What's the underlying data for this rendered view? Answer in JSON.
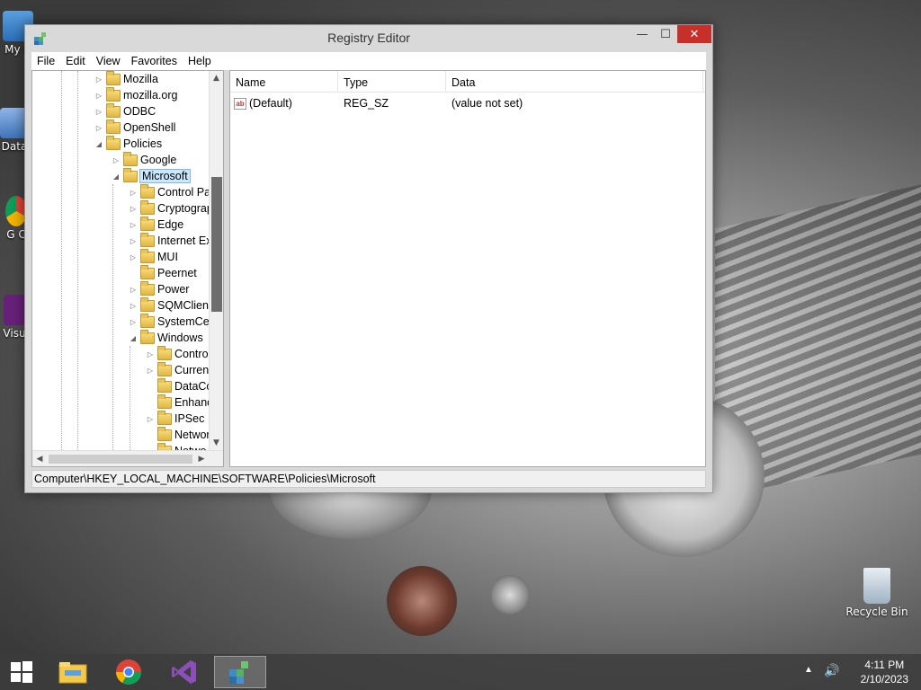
{
  "desktop": {
    "icons": [
      {
        "name": "my-computer-icon",
        "label": "My C"
      },
      {
        "name": "data-shortcut-icon",
        "label": "Data"
      },
      {
        "name": "google-chrome-shortcut-icon",
        "label": "G C"
      },
      {
        "name": "visual-studio-shortcut-icon",
        "label": "Visu"
      },
      {
        "name": "recycle-bin-icon",
        "label": "Recycle Bin"
      }
    ]
  },
  "window": {
    "title": "Registry Editor",
    "controls": {
      "minimize": "—",
      "maximize": "☐",
      "close": "✕"
    }
  },
  "menubar": {
    "items": [
      "File",
      "Edit",
      "View",
      "Favorites",
      "Help"
    ]
  },
  "tree": {
    "rows": [
      {
        "label": "Mozilla",
        "expander": "▷",
        "depth": 0
      },
      {
        "label": "mozilla.org",
        "expander": "▷",
        "depth": 0
      },
      {
        "label": "ODBC",
        "expander": "▷",
        "depth": 0
      },
      {
        "label": "OpenShell",
        "expander": "▷",
        "depth": 0
      },
      {
        "label": "Policies",
        "expander": "◢",
        "depth": 0
      },
      {
        "label": "Google",
        "expander": "▷",
        "depth": 1
      },
      {
        "label": "Microsoft",
        "expander": "◢",
        "depth": 1,
        "selected": true
      },
      {
        "label": "Control Pa",
        "expander": "▷",
        "depth": 2
      },
      {
        "label": "Cryptograp",
        "expander": "▷",
        "depth": 2
      },
      {
        "label": "Edge",
        "expander": "▷",
        "depth": 2
      },
      {
        "label": "Internet Ex",
        "expander": "▷",
        "depth": 2
      },
      {
        "label": "MUI",
        "expander": "▷",
        "depth": 2
      },
      {
        "label": "Peernet",
        "expander": "",
        "depth": 2
      },
      {
        "label": "Power",
        "expander": "▷",
        "depth": 2
      },
      {
        "label": "SQMClient",
        "expander": "▷",
        "depth": 2
      },
      {
        "label": "SystemCer",
        "expander": "▷",
        "depth": 2
      },
      {
        "label": "Windows",
        "expander": "◢",
        "depth": 2
      },
      {
        "label": "Contro",
        "expander": "▷",
        "depth": 3
      },
      {
        "label": "Current",
        "expander": "▷",
        "depth": 3
      },
      {
        "label": "DataCo",
        "expander": "",
        "depth": 3
      },
      {
        "label": "Enhanc",
        "expander": "",
        "depth": 3
      },
      {
        "label": "IPSec",
        "expander": "▷",
        "depth": 3
      },
      {
        "label": "Networ",
        "expander": "",
        "depth": 3
      },
      {
        "label": "Netwo",
        "expander": "",
        "depth": 3
      }
    ]
  },
  "list": {
    "columns": [
      "Name",
      "Type",
      "Data"
    ],
    "rows": [
      {
        "icon": "ab",
        "name": "(Default)",
        "type": "REG_SZ",
        "data": "(value not set)"
      }
    ]
  },
  "statusbar": {
    "path": "Computer\\HKEY_LOCAL_MACHINE\\SOFTWARE\\Policies\\Microsoft"
  },
  "taskbar": {
    "apps": [
      {
        "name": "file-explorer-taskbar-button",
        "active": false
      },
      {
        "name": "chrome-taskbar-button",
        "active": false
      },
      {
        "name": "visual-studio-taskbar-button",
        "active": false
      },
      {
        "name": "registry-editor-taskbar-button",
        "active": true
      }
    ],
    "clock": {
      "time": "4:11 PM",
      "date": "2/10/2023"
    }
  },
  "colors": {
    "close_button": "#c7302a",
    "selection": "#cce8ff",
    "folder": "#e2b544"
  }
}
